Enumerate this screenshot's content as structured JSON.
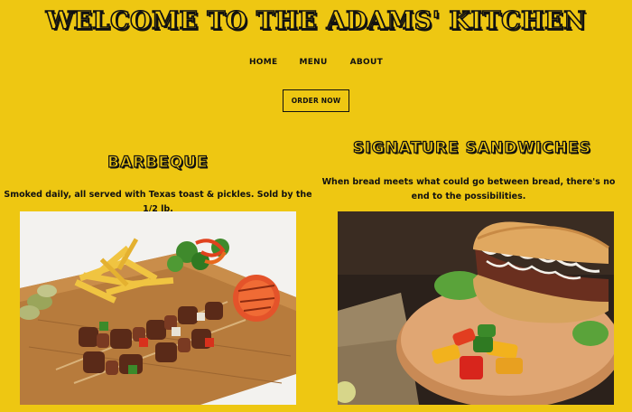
{
  "header": {
    "title": "WELCOME TO THE ADAMS' KITCHEN"
  },
  "nav": {
    "items": [
      "HOME",
      "MENU",
      "ABOUT"
    ]
  },
  "cta": {
    "label": "ORDER NOW"
  },
  "sections": [
    {
      "title": "BARBEQUE",
      "description": "Smoked daily, all served with Texas toast & pickles. Sold by the 1/2 lb.",
      "image": "barbeque-skewers-fries-photo"
    },
    {
      "title": "SIGNATURE SANDWICHES",
      "description": "When bread meets what could go between bread, there's no end to the possibilities.",
      "image": "sandwich-on-board-photo"
    }
  ],
  "colors": {
    "background": "#eec712",
    "text": "#111111"
  }
}
